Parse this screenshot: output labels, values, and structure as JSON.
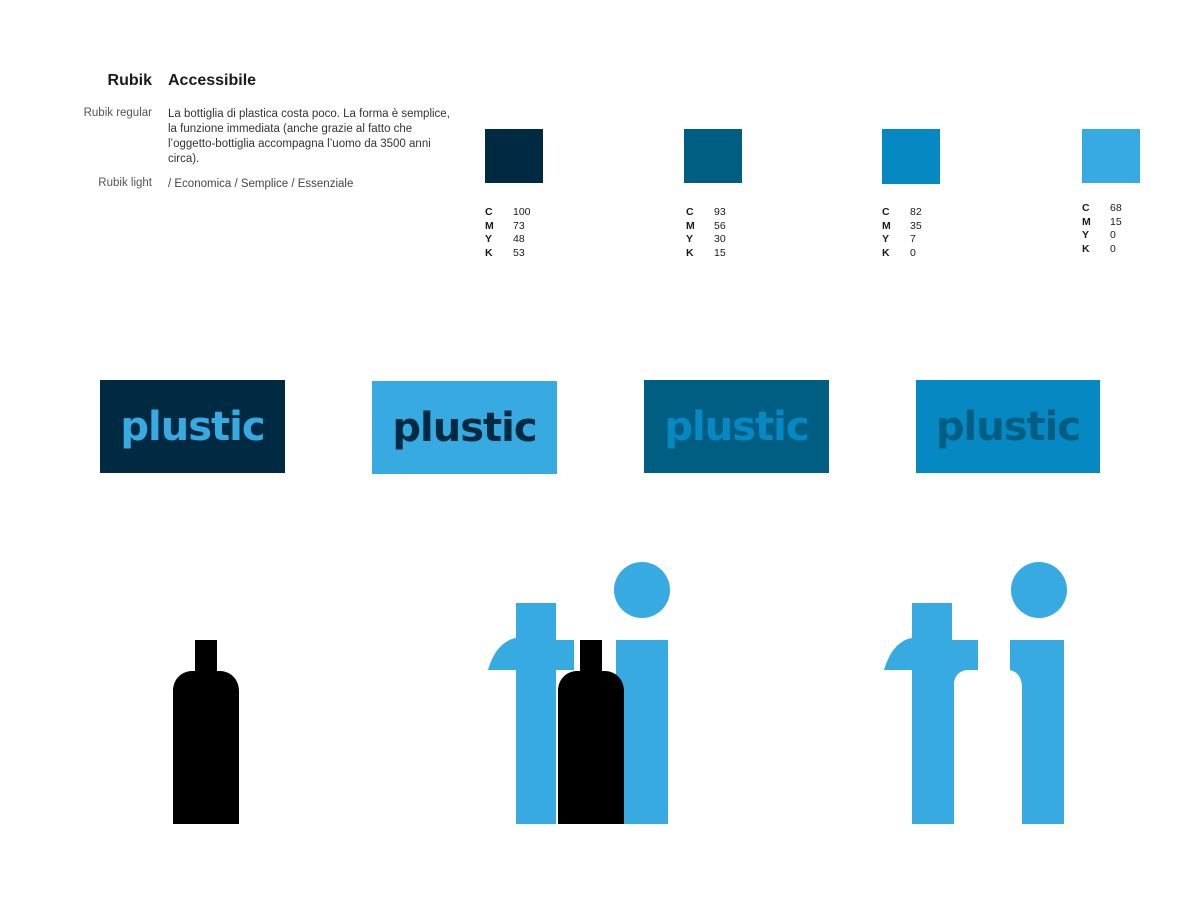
{
  "typography": {
    "font_name": "Rubik",
    "heading": "Accessibile",
    "regular_label": "Rubik regular",
    "regular_text": "La bottiglia di plastica costa poco. La forma è semplice, la funzione immediata (anche grazie al fatto che l’oggetto-bottiglia accompagna l’uomo da 3500 anni circa).",
    "light_label": "Rubik light",
    "light_text": "/ Economica / Semplice / Essenziale"
  },
  "palette": [
    {
      "color": "#002a41",
      "cmyk": {
        "C": "100",
        "M": "73",
        "Y": "48",
        "K": "53"
      }
    },
    {
      "color": "#005e83",
      "cmyk": {
        "C": "93",
        "M": "56",
        "Y": "30",
        "K": "15"
      }
    },
    {
      "color": "#0688c2",
      "cmyk": {
        "C": "82",
        "M": "35",
        "Y": "7",
        "K": "0"
      }
    },
    {
      "color": "#37aae1",
      "cmyk": {
        "C": "68",
        "M": "15",
        "Y": "0",
        "K": "0"
      }
    }
  ],
  "logo_variants": [
    {
      "text": "plustic",
      "background": "#002a41",
      "text_color": "#37aae1"
    },
    {
      "text": "plustic",
      "background": "#37aae1",
      "text_color": "#002a41"
    },
    {
      "text": "plustic",
      "background": "#005e83",
      "text_color": "#0688c2"
    },
    {
      "text": "plustic",
      "background": "#0688c2",
      "text_color": "#005e83"
    }
  ],
  "icons": {
    "bottle_color": "#000000",
    "ti_color": "#37aae1",
    "sequence": [
      "bottle-icon",
      "ti-with-bottle-icon",
      "ti-icon"
    ]
  }
}
